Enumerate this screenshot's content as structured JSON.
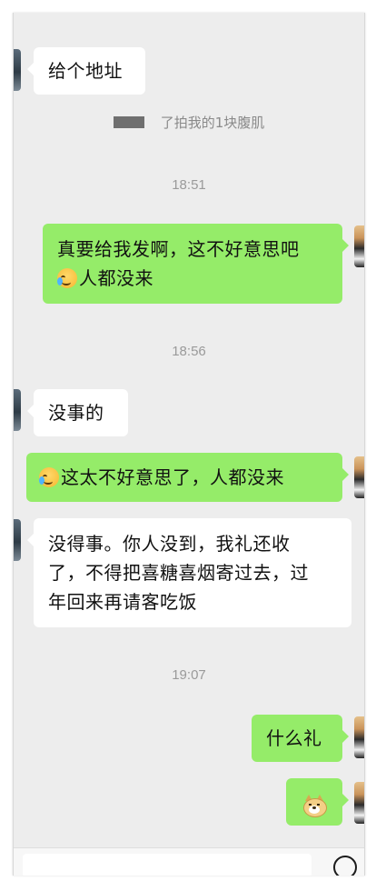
{
  "messages": {
    "m1": {
      "text": "给个地址"
    },
    "system1": {
      "text": "了拍我的1块腹肌"
    },
    "time1": "18:51",
    "m2": {
      "line1": "真要给我发啊，这不好意思吧",
      "line2": "人都没来"
    },
    "time2": "18:56",
    "m3": {
      "text": "没事的"
    },
    "m4": {
      "text": "这太不好意思了，人都没来"
    },
    "m5": {
      "line1": "没得事。你人没到，我礼还收",
      "line2": "了，不得把喜糖喜烟寄过去，过",
      "line3": "年回来再请客吃饭"
    },
    "time3": "19:07",
    "m6": {
      "text": "什么礼"
    }
  },
  "icons": {
    "cry_laugh": "crying-laughing-emoji-icon",
    "doge": "doge-emoji-icon",
    "input_action": "voice-input-icon"
  },
  "colors": {
    "chat_bg": "#ededed",
    "sent_bubble": "#95ec69",
    "recv_bubble": "#ffffff",
    "timestamp": "#9a9a9a"
  }
}
